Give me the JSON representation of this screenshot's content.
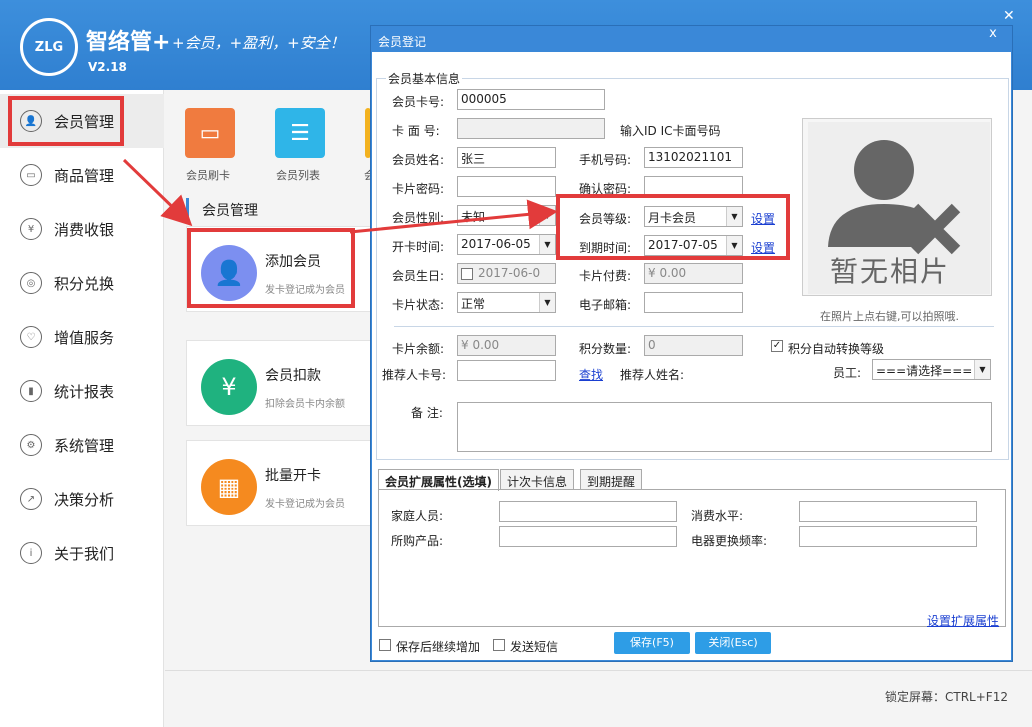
{
  "app": {
    "name": "智络管+",
    "slogan": "+会员，+盈利，+安全！",
    "version": "V2.18",
    "logo_text": "ZLG"
  },
  "sidebar": {
    "items": [
      {
        "label": "会员管理",
        "icon": "user-icon"
      },
      {
        "label": "商品管理",
        "icon": "bag-icon"
      },
      {
        "label": "消费收银",
        "icon": "yen-icon"
      },
      {
        "label": "积分兑换",
        "icon": "points-icon"
      },
      {
        "label": "增值服务",
        "icon": "heart-icon"
      },
      {
        "label": "统计报表",
        "icon": "chart-icon"
      },
      {
        "label": "系统管理",
        "icon": "gear-icon"
      },
      {
        "label": "决策分析",
        "icon": "trend-icon"
      },
      {
        "label": "关于我们",
        "icon": "info-icon"
      }
    ]
  },
  "quick": {
    "tiles": [
      {
        "label": "会员刷卡"
      },
      {
        "label": "会员列表"
      },
      {
        "label": "会"
      }
    ]
  },
  "section_title": "会员管理",
  "cards": [
    {
      "title": "添加会员",
      "sub": "发卡登记成为会员"
    },
    {
      "title": "会员扣款",
      "sub": "扣除会员卡内余额"
    },
    {
      "title": "批量开卡",
      "sub": "发卡登记成为会员"
    }
  ],
  "lock_hint": "锁定屏幕：CTRL+F12",
  "dialog": {
    "title": "会员登记",
    "close": "x",
    "group_title": "会员基本信息",
    "fields": {
      "card_no": {
        "label": "会员卡号:",
        "value": "000005"
      },
      "card_face": {
        "label": "卡 面 号:",
        "value": ""
      },
      "card_face_hint": "输入ID IC卡面号码",
      "name": {
        "label": "会员姓名:",
        "value": "张三"
      },
      "phone": {
        "label": "手机号码:",
        "value": "13102021101"
      },
      "password": {
        "label": "卡片密码:",
        "value": ""
      },
      "confirm": {
        "label": "确认密码:",
        "value": ""
      },
      "gender": {
        "label": "会员性别:",
        "value": "未知"
      },
      "level": {
        "label": "会员等级:",
        "value": "月卡会员",
        "link": "设置"
      },
      "open_time": {
        "label": "开卡时间:",
        "value": "2017-06-05"
      },
      "expire": {
        "label": "到期时间:",
        "value": "2017-07-05",
        "link": "设置"
      },
      "birthday": {
        "label": "会员生日:",
        "value": "2017-06-0"
      },
      "card_fee": {
        "label": "卡片付费:",
        "value": "¥ 0.00"
      },
      "status": {
        "label": "卡片状态:",
        "value": "正常"
      },
      "email": {
        "label": "电子邮箱:",
        "value": ""
      },
      "balance": {
        "label": "卡片余额:",
        "value": "¥ 0.00"
      },
      "points": {
        "label": "积分数量:",
        "value": "0"
      },
      "auto_level": {
        "label": "积分自动转换等级",
        "checked": true
      },
      "referrer_card": {
        "label": "推荐人卡号:",
        "value": "",
        "link": "查找"
      },
      "referrer_name": {
        "label": "推荐人姓名:"
      },
      "staff": {
        "label": "员工:",
        "value": "===请选择==="
      },
      "memo": {
        "label": "备 注:",
        "value": ""
      }
    },
    "photo": {
      "text": "暂无相片",
      "hint": "在照片上点右键,可以拍照哦."
    },
    "tabs": [
      {
        "label": "会员扩展属性(选填)",
        "active": true
      },
      {
        "label": "计次卡信息"
      },
      {
        "label": "到期提醒"
      }
    ],
    "ext": {
      "family": "家庭人员:",
      "consume": "消费水平:",
      "product": "所购产品:",
      "freq": "电器更换频率:",
      "link": "设置扩展属性"
    },
    "footer": {
      "keep_adding": "保存后继续增加",
      "send_sms": "发送短信",
      "save": "保存(F5)",
      "close": "关闭(Esc)"
    }
  }
}
